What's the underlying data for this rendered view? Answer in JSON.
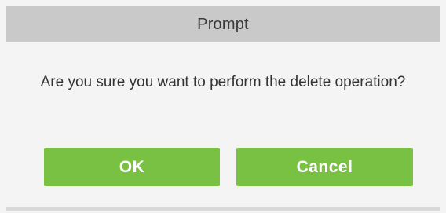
{
  "dialog": {
    "title": "Prompt",
    "message": "Are you sure you want to perform the delete operation?",
    "buttons": {
      "ok_label": "OK",
      "cancel_label": "Cancel"
    }
  },
  "colors": {
    "titlebar": "#c9c9c9",
    "button": "#79c142",
    "background": "#f4f4f4"
  }
}
